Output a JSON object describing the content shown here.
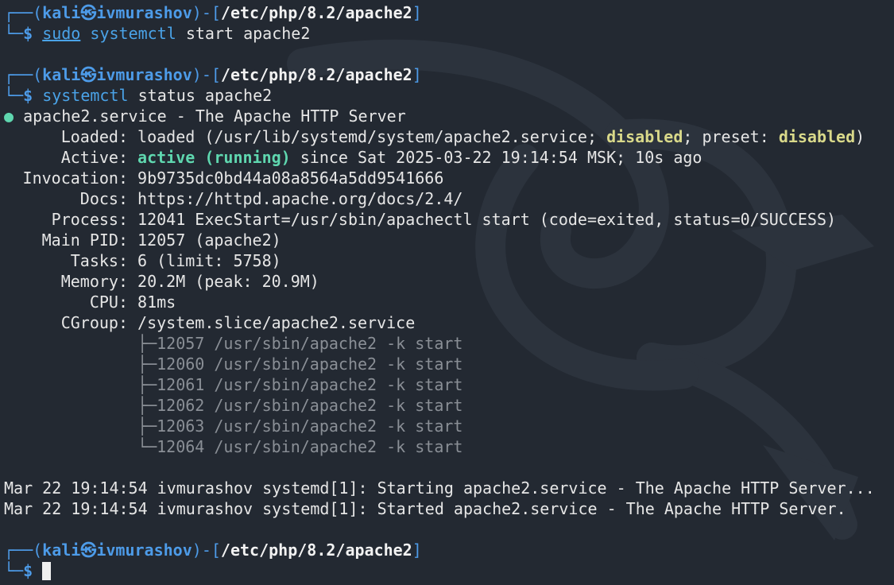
{
  "prompt": {
    "corner_top": "┌──",
    "corner_bottom": "└─",
    "open": "(",
    "user": "kali",
    "at_icon": "㉿",
    "host": "ivmurashov",
    "close": ")",
    "dash": "-",
    "lb": "[",
    "path": "/etc/php/8.2/apache2",
    "rb": "]",
    "dollar": "$"
  },
  "commands": {
    "first_sudo": "sudo",
    "first_rest_cmd": "systemctl",
    "first_args": "start apache2",
    "second_cmd": "systemctl",
    "second_args": "status apache2"
  },
  "status": {
    "bullet": "●",
    "header": "apache2.service - The Apache HTTP Server",
    "loaded_label": "Loaded:",
    "loaded_pre": "loaded (/usr/lib/systemd/system/apache2.service; ",
    "loaded_disabled1": "disabled",
    "loaded_mid": "; preset: ",
    "loaded_disabled2": "disabled",
    "loaded_post": ")",
    "active_label": "Active:",
    "active_state": "active (running)",
    "active_rest": "since Sat 2025-03-22 19:14:54 MSK; 10s ago",
    "invocation_label": "Invocation:",
    "invocation_value": "9b9735dc0bd44a08a8564a5dd9541666",
    "docs_label": "Docs:",
    "docs_value": "https://httpd.apache.org/docs/2.4/",
    "process_label": "Process:",
    "process_value": "12041 ExecStart=/usr/sbin/apachectl start (code=exited, status=0/SUCCESS)",
    "mainpid_label": "Main PID:",
    "mainpid_value": "12057 (apache2)",
    "tasks_label": "Tasks:",
    "tasks_value": "6 (limit: 5758)",
    "memory_label": "Memory:",
    "memory_value": "20.2M (peak: 20.9M)",
    "cpu_label": "CPU:",
    "cpu_value": "81ms",
    "cgroup_label": "CGroup:",
    "cgroup_value": "/system.slice/apache2.service"
  },
  "cgroup_tree": [
    {
      "branch": "├─",
      "text": "12057 /usr/sbin/apache2 -k start"
    },
    {
      "branch": "├─",
      "text": "12060 /usr/sbin/apache2 -k start"
    },
    {
      "branch": "├─",
      "text": "12061 /usr/sbin/apache2 -k start"
    },
    {
      "branch": "├─",
      "text": "12062 /usr/sbin/apache2 -k start"
    },
    {
      "branch": "├─",
      "text": "12063 /usr/sbin/apache2 -k start"
    },
    {
      "branch": "└─",
      "text": "12064 /usr/sbin/apache2 -k start"
    }
  ],
  "log": {
    "line1": "Mar 22 19:14:54 ivmurashov systemd[1]: Starting apache2.service - The Apache HTTP Server...",
    "line2": "Mar 22 19:14:54 ivmurashov systemd[1]: Started apache2.service - The Apache HTTP Server."
  },
  "colors": {
    "background": "#232932",
    "prompt_blue": "#4d9be8",
    "active_green": "#5fd7af",
    "disabled_yellow": "#d9d98a",
    "tree_gray": "#8a8f96"
  },
  "icons": {
    "background_watermark": "kali-dragon-icon"
  }
}
